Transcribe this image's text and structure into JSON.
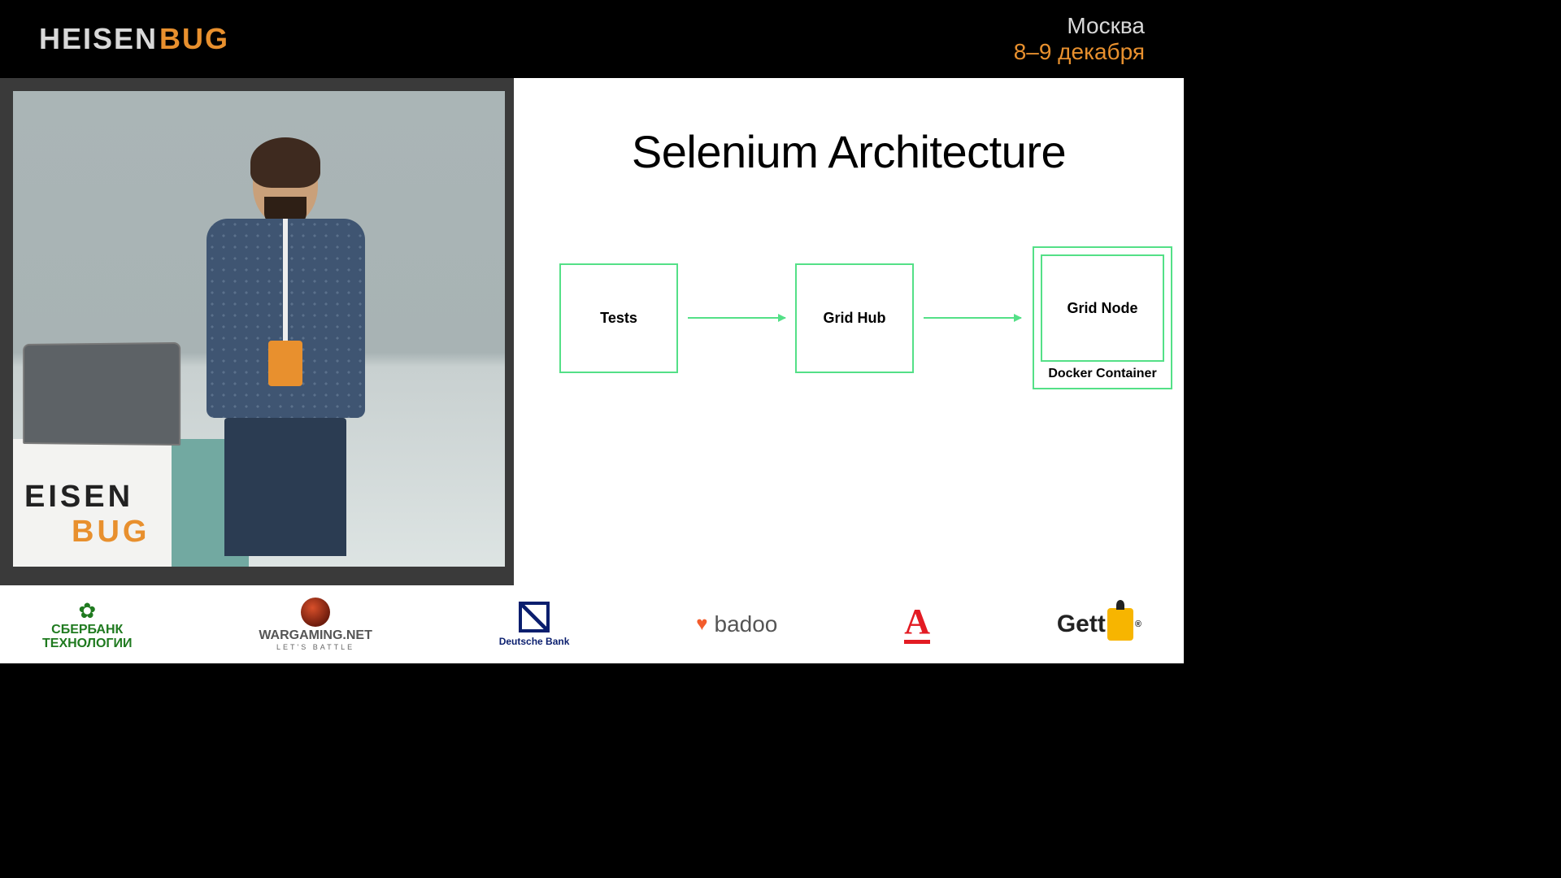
{
  "header": {
    "logo_part1": "HEISEN",
    "logo_part2": "BUG",
    "city": "Москва",
    "dates": "8–9 декабря"
  },
  "slide": {
    "title": "Selenium Architecture",
    "boxes": [
      "Tests",
      "Grid Hub",
      "Grid Node"
    ],
    "container_label": "Docker Container"
  },
  "video_overlay": {
    "logo_line1": "EISEN",
    "logo_line2": "BUG"
  },
  "sponsors": {
    "sberbank": {
      "line1": "СБЕРБАНК",
      "line2": "ТЕХНОЛОГИИ"
    },
    "wargaming": {
      "name": "WARGAMING.NET",
      "sub": "LET'S BATTLE"
    },
    "deutschebank": "Deutsche Bank",
    "badoo": "badoo",
    "alfa": "A",
    "gett": "Gett",
    "gett_r": "®"
  }
}
